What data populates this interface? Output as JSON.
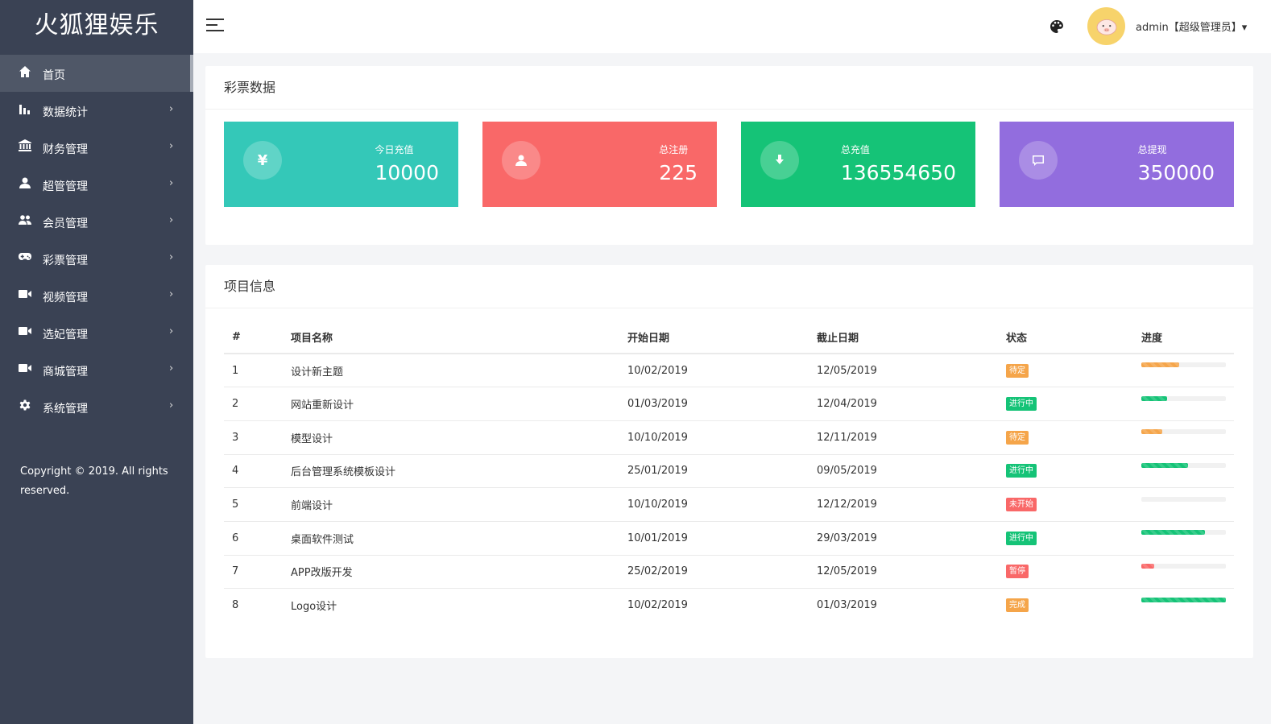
{
  "app": {
    "title": "火狐狸娱乐"
  },
  "sidebar": {
    "items": [
      {
        "label": "首页",
        "icon": "home-icon",
        "active": true
      },
      {
        "label": "数据统计",
        "icon": "bar-chart-icon"
      },
      {
        "label": "财务管理",
        "icon": "bank-icon"
      },
      {
        "label": "超管管理",
        "icon": "user-icon"
      },
      {
        "label": "会员管理",
        "icon": "users-icon"
      },
      {
        "label": "彩票管理",
        "icon": "gamepad-icon"
      },
      {
        "label": "视频管理",
        "icon": "video-icon"
      },
      {
        "label": "选妃管理",
        "icon": "video-icon"
      },
      {
        "label": "商城管理",
        "icon": "video-icon"
      },
      {
        "label": "系统管理",
        "icon": "gear-icon"
      }
    ],
    "arrow": "›",
    "copyright": "Copyright © 2019. All rights reserved."
  },
  "header": {
    "user": "admin【超级管理员】▾"
  },
  "lottery": {
    "title": "彩票数据",
    "cards": [
      {
        "label": "今日充值",
        "value": "10000",
        "icon": "yen-icon",
        "color": "#34c8b8"
      },
      {
        "label": "总注册",
        "value": "225",
        "icon": "user-icon",
        "color": "#f96868"
      },
      {
        "label": "总充值",
        "value": "136554650",
        "icon": "download-icon",
        "color": "#15c377"
      },
      {
        "label": "总提现",
        "value": "350000",
        "icon": "message-icon",
        "color": "#926dde"
      }
    ]
  },
  "projects": {
    "title": "项目信息",
    "columns": [
      "#",
      "项目名称",
      "开始日期",
      "截止日期",
      "状态",
      "进度"
    ],
    "rows": [
      {
        "id": "1",
        "name": "设计新主题",
        "start": "10/02/2019",
        "end": "12/05/2019",
        "status": "待定",
        "status_color": "#f5a54a",
        "progress": 45,
        "progress_color": "#f5a54a"
      },
      {
        "id": "2",
        "name": "网站重新设计",
        "start": "01/03/2019",
        "end": "12/04/2019",
        "status": "进行中",
        "status_color": "#15c377",
        "progress": 30,
        "progress_color": "#15c377"
      },
      {
        "id": "3",
        "name": "模型设计",
        "start": "10/10/2019",
        "end": "12/11/2019",
        "status": "待定",
        "status_color": "#f5a54a",
        "progress": 25,
        "progress_color": "#f5a54a"
      },
      {
        "id": "4",
        "name": "后台管理系统模板设计",
        "start": "25/01/2019",
        "end": "09/05/2019",
        "status": "进行中",
        "status_color": "#15c377",
        "progress": 55,
        "progress_color": "#15c377"
      },
      {
        "id": "5",
        "name": "前端设计",
        "start": "10/10/2019",
        "end": "12/12/2019",
        "status": "未开始",
        "status_color": "#f96868",
        "progress": 0,
        "progress_color": "#f96868"
      },
      {
        "id": "6",
        "name": "桌面软件测试",
        "start": "10/01/2019",
        "end": "29/03/2019",
        "status": "进行中",
        "status_color": "#15c377",
        "progress": 75,
        "progress_color": "#15c377"
      },
      {
        "id": "7",
        "name": "APP改版开发",
        "start": "25/02/2019",
        "end": "12/05/2019",
        "status": "暂停",
        "status_color": "#f96868",
        "progress": 15,
        "progress_color": "#f96868"
      },
      {
        "id": "8",
        "name": "Logo设计",
        "start": "10/02/2019",
        "end": "01/03/2019",
        "status": "完成",
        "status_color": "#f5a54a",
        "progress": 100,
        "progress_color": "#15c377"
      }
    ]
  }
}
